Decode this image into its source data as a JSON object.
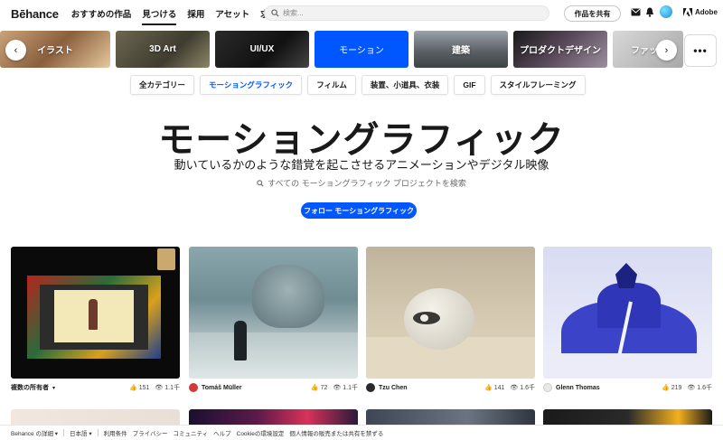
{
  "header": {
    "logo": "Bēhance",
    "nav": [
      "おすすめの作品",
      "見つける",
      "採用",
      "アセット",
      "求人"
    ],
    "search_placeholder": "検索...",
    "share_button": "作品を共有",
    "adobe": "Adobe"
  },
  "categories": [
    "イラスト",
    "3D Art",
    "UI/UX",
    "モーション",
    "建築",
    "プロダクトデザイン",
    "ファッ"
  ],
  "more_label": "•••",
  "subcategories": [
    "全カテゴリー",
    "モーショングラフィック",
    "フィルム",
    "装置、小道具、衣装",
    "GIF",
    "スタイルフレーミング"
  ],
  "hero": {
    "title": "モーショングラフィック",
    "subtitle": "動いているかのような錯覚を起こさせるアニメーションやデジタル映像",
    "search_text": "すべての モーショングラフィック プロジェクトを検索",
    "follow_button": "フォロー モーショングラフィック"
  },
  "cards": [
    {
      "owner": "複数の所有者",
      "likes": "151",
      "views": "1.1千"
    },
    {
      "owner": "Tomáš Müller",
      "likes": "72",
      "views": "1.1千"
    },
    {
      "owner": "Tzu Chen",
      "likes": "141",
      "views": "1.6千"
    },
    {
      "owner": "Glenn Thomas",
      "likes": "219",
      "views": "1.6千"
    }
  ],
  "footer": {
    "links": [
      "Behance の詳細",
      "日本語",
      "利用条件",
      "プライバシー",
      "コミュニティ",
      "ヘルプ",
      "Cookieの環境設定",
      "個人情報の販売または共有を禁ずる"
    ]
  }
}
